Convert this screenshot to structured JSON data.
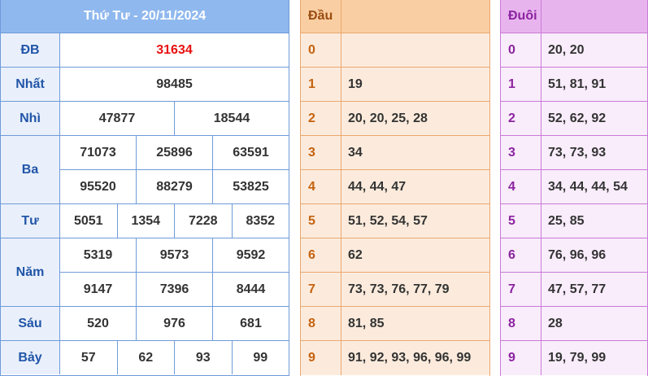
{
  "results": {
    "title": "Thứ Tư - 20/11/2024",
    "special_color": "#e8100f",
    "prizes": [
      {
        "label": "ĐB",
        "lines": [
          [
            "31634"
          ]
        ]
      },
      {
        "label": "Nhất",
        "lines": [
          [
            "98485"
          ]
        ]
      },
      {
        "label": "Nhì",
        "lines": [
          [
            "47877",
            "18544"
          ]
        ]
      },
      {
        "label": "Ba",
        "lines": [
          [
            "71073",
            "25896",
            "63591"
          ],
          [
            "95520",
            "88279",
            "53825"
          ]
        ]
      },
      {
        "label": "Tư",
        "lines": [
          [
            "5051",
            "1354",
            "7228",
            "8352"
          ]
        ]
      },
      {
        "label": "Năm",
        "lines": [
          [
            "5319",
            "9573",
            "9592"
          ],
          [
            "9147",
            "7396",
            "8444"
          ]
        ]
      },
      {
        "label": "Sáu",
        "lines": [
          [
            "520",
            "976",
            "681"
          ]
        ]
      },
      {
        "label": "Bảy",
        "lines": [
          [
            "57",
            "62",
            "93",
            "99"
          ]
        ]
      }
    ]
  },
  "dau": {
    "header": "Đầu",
    "rows": [
      {
        "key": "0",
        "value": ""
      },
      {
        "key": "1",
        "value": "19"
      },
      {
        "key": "2",
        "value": "20, 20, 25, 28"
      },
      {
        "key": "3",
        "value": "34"
      },
      {
        "key": "4",
        "value": "44, 44, 47"
      },
      {
        "key": "5",
        "value": "51, 52, 54, 57"
      },
      {
        "key": "6",
        "value": "62"
      },
      {
        "key": "7",
        "value": "73, 73, 76, 77, 79"
      },
      {
        "key": "8",
        "value": "81, 85"
      },
      {
        "key": "9",
        "value": "91, 92, 93, 96, 96, 99"
      }
    ]
  },
  "duoi": {
    "header": "Đuôi",
    "rows": [
      {
        "key": "0",
        "value": "20, 20"
      },
      {
        "key": "1",
        "value": "51, 81, 91"
      },
      {
        "key": "2",
        "value": "52, 62, 92"
      },
      {
        "key": "3",
        "value": "73, 73, 93"
      },
      {
        "key": "4",
        "value": "34, 44, 44, 54"
      },
      {
        "key": "5",
        "value": "25, 85"
      },
      {
        "key": "6",
        "value": "76, 96, 96"
      },
      {
        "key": "7",
        "value": "47, 57, 77"
      },
      {
        "key": "8",
        "value": "28"
      },
      {
        "key": "9",
        "value": "19, 79, 99"
      }
    ]
  }
}
